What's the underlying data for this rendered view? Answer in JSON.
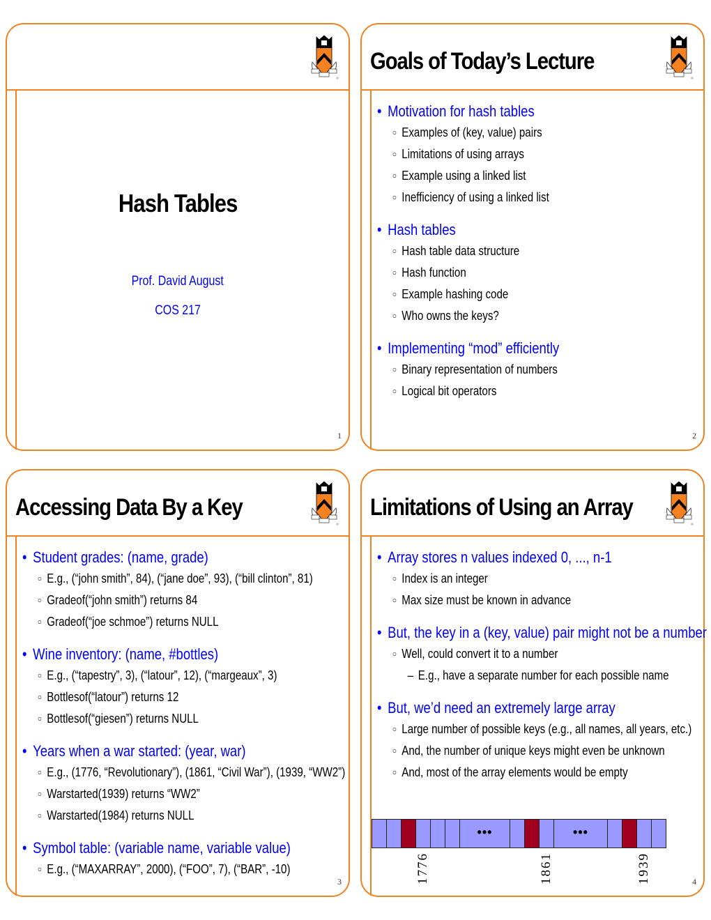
{
  "colors": {
    "border": "#f58220",
    "heading_blue": "#0000ff",
    "array_cell": "#9999ff",
    "array_highlight": "#a0001e"
  },
  "logo": "princeton-shield-icon",
  "slides": [
    {
      "number": "1",
      "title": "Hash Tables",
      "author": "Prof. David August",
      "course": "COS 217"
    },
    {
      "number": "2",
      "title": "Goals of Today’s Lecture",
      "sections": [
        {
          "heading": "Motivation for hash tables",
          "items": [
            "Examples of (key, value) pairs",
            "Limitations of using arrays",
            "Example using a linked list",
            "Inefficiency of using a linked list"
          ]
        },
        {
          "heading": "Hash tables",
          "items": [
            "Hash table data structure",
            "Hash function",
            "Example hashing code",
            "Who owns the keys?"
          ]
        },
        {
          "heading": "Implementing “mod” efficiently",
          "items": [
            "Binary representation of numbers",
            "Logical bit operators"
          ]
        }
      ]
    },
    {
      "number": "3",
      "title": "Accessing Data By a Key",
      "sections": [
        {
          "heading": "Student grades: (name, grade)",
          "items": [
            "E.g., (“john smith”, 84), (“jane doe”, 93), (“bill clinton”, 81)",
            "Gradeof(“john smith”) returns 84",
            "Gradeof(“joe schmoe”) returns NULL"
          ]
        },
        {
          "heading": "Wine inventory: (name, #bottles)",
          "items": [
            "E.g., (“tapestry”, 3), (“latour”, 12), (“margeaux”, 3)",
            "Bottlesof(“latour”) returns 12",
            "Bottlesof(“giesen”) returns NULL"
          ]
        },
        {
          "heading": "Years when a war started: (year, war)",
          "items": [
            "E.g., (1776, “Revolutionary”), (1861, “Civil War”), (1939, “WW2”)",
            "Warstarted(1939) returns “WW2”",
            "Warstarted(1984) returns NULL"
          ]
        },
        {
          "heading": "Symbol table: (variable name, variable value)",
          "items": [
            "E.g., (“MAXARRAY”, 2000), (“FOO”, 7), (“BAR”, -10)"
          ]
        }
      ]
    },
    {
      "number": "4",
      "title": "Limitations of Using an Array",
      "sections": [
        {
          "heading": "Array stores n values indexed 0, ..., n-1",
          "items": [
            "Index is an integer",
            "Max size must be known in advance"
          ]
        },
        {
          "heading": "But, the key in a (key, value) pair might not be a number",
          "items": [
            "Well, could convert it to a number"
          ],
          "subitems": [
            "E.g., have a separate number for each possible name"
          ]
        },
        {
          "heading": "But, we’d need an extremely large array",
          "items": [
            "Large number of possible keys (e.g., all names, all years, etc.)",
            "And, the number of unique keys might even be unknown",
            "And, most of the array elements would be empty"
          ]
        }
      ],
      "array_diagram": {
        "ellipsis": "•••",
        "labels": [
          "1776",
          "1861",
          "1939"
        ]
      }
    }
  ]
}
